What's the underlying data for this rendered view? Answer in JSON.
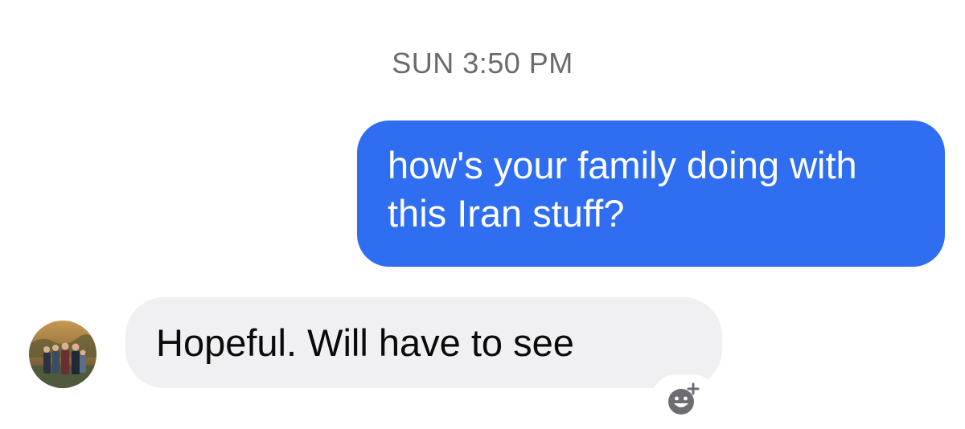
{
  "conversation": {
    "timestamp": "SUN 3:50 PM",
    "messages": [
      {
        "direction": "outgoing",
        "text": "how's your family doing with this Iran stuff?"
      },
      {
        "direction": "incoming",
        "text": "Hopeful. Will have to see"
      }
    ]
  },
  "icons": {
    "avatar": "avatar",
    "reaction": "add-reaction-icon"
  },
  "colors": {
    "outgoing_bubble": "#2f6ef1",
    "incoming_bubble": "#f0f0f2",
    "timestamp_text": "#6b6b6b"
  }
}
